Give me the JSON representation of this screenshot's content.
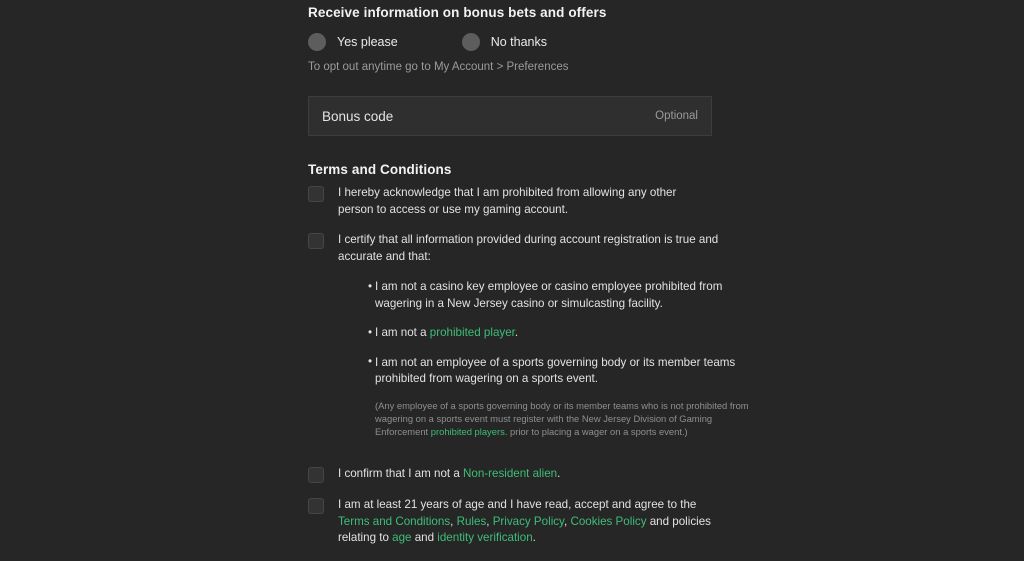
{
  "bonus_section": {
    "heading": "Receive information on bonus bets and offers",
    "options": [
      {
        "label": "Yes please",
        "selected": false
      },
      {
        "label": "No thanks",
        "selected": false
      }
    ],
    "opt_out_note": "To opt out anytime go to My Account > Preferences",
    "bonus_code_field": {
      "label": "Bonus code",
      "value": "",
      "optional_tag": "Optional"
    }
  },
  "terms_section": {
    "heading": "Terms and Conditions",
    "items": [
      {
        "id": "acknowledge-account-access",
        "checked": false,
        "text": "I hereby acknowledge that I am prohibited from allowing any other person to access or use my gaming account."
      },
      {
        "id": "certify-information",
        "checked": false,
        "text": "I certify that all information provided during account registration is true and accurate and that:",
        "bullets": [
          {
            "id": "not-casino-employee",
            "prefix": "I am not a casino key employee or casino employee prohibited from wagering in a New Jersey casino or simulcasting facility.",
            "link": "",
            "suffix": ""
          },
          {
            "id": "not-prohibited-player",
            "prefix": "I am not a ",
            "link": "prohibited player",
            "suffix": "."
          },
          {
            "id": "not-sports-body-employee",
            "prefix": "I am not an employee of a sports governing body or its member teams prohibited from wagering on a sports event.",
            "link": "",
            "suffix": ""
          }
        ],
        "fine_print": {
          "prefix": "(Any employee of a sports governing body or its member teams who is not prohibited from wagering on a sports event must register with the New Jersey Division of Gaming Enforcement ",
          "link": "prohibited players.",
          "suffix": " prior to placing a wager on a sports event.)"
        }
      },
      {
        "id": "non-resident-alien",
        "checked": false,
        "prefix": "I confirm that I am not a ",
        "link": "Non-resident alien",
        "suffix": "."
      },
      {
        "id": "age-and-policies",
        "checked": false,
        "segments": [
          {
            "text": "I am at least 21 years of age and I have read, accept and agree to the ",
            "link": false
          },
          {
            "text": "Terms and Conditions",
            "link": true
          },
          {
            "text": ", ",
            "link": false
          },
          {
            "text": "Rules",
            "link": true
          },
          {
            "text": ", ",
            "link": false
          },
          {
            "text": "Privacy Policy",
            "link": true
          },
          {
            "text": ", ",
            "link": false
          },
          {
            "text": "Cookies Policy",
            "link": true
          },
          {
            "text": " and policies relating to ",
            "link": false
          },
          {
            "text": "age",
            "link": true
          },
          {
            "text": " and ",
            "link": false
          },
          {
            "text": "identity verification",
            "link": true
          },
          {
            "text": ".",
            "link": false
          }
        ]
      }
    ]
  },
  "colors": {
    "background": "#262626",
    "link_green": "#3ebd78",
    "field_background": "#2f2f2f",
    "muted_text": "#9a9a9a"
  }
}
